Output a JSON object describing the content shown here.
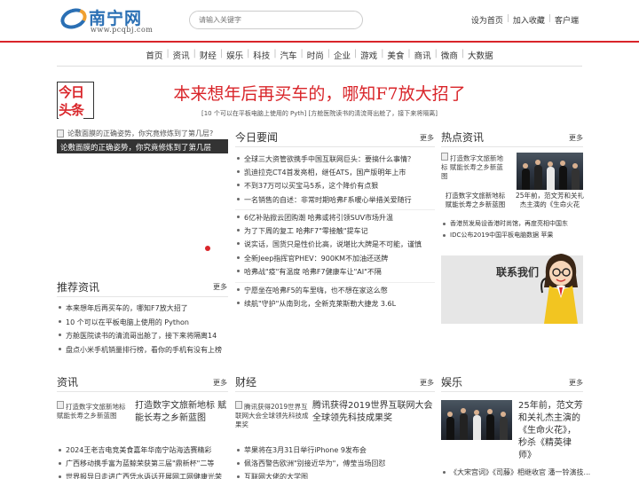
{
  "header": {
    "logo_text": "南宁网",
    "logo_url": "www.pcqbj.com",
    "search_placeholder": "请输入关键字",
    "links": [
      "设为首页",
      "加入收藏",
      "客户端"
    ]
  },
  "nav": [
    "首页",
    "资讯",
    "财经",
    "娱乐",
    "科技",
    "汽车",
    "时尚",
    "企业",
    "游戏",
    "美食",
    "商讯",
    "微商",
    "大数据"
  ],
  "headline": {
    "badge_top": "今日",
    "badge_bottom": "头条",
    "title": "本来想年后再买车的，哪知F7放大招了",
    "sub": "[10 个可以在平板电脑上使用的 Pyth]  [方舱医院读书的清流哥出舱了，接下来将隔离]"
  },
  "banner": {
    "img_alt": "论敷面膜的正确姿势，你究竟修炼到了第几层?",
    "caption": "论敷面膜的正确姿势，你究竟修炼到了第几层"
  },
  "today": {
    "title": "今日要闻",
    "more": "更多",
    "group1": [
      "全球三大资管欲携手中国互联网巨头：要搞什么事情？",
      "凯迪拉克CT4首发亮相，继任ATS，国产版明年上市",
      "不到37万可以买宝马5系，这个降价有点狠",
      "一名销售的自述：非常时期哈弗F系暖心举措关爱随行"
    ],
    "group2": [
      "6亿补贴掀云团购潮 哈弗或将引领SUV市场升温",
      "为了下周的复工 哈弗F7\"零接触\"提车记",
      "说实话，国货只是性价比高，说堪比大牌是不可能，谨慎",
      "全新Jeep指挥官PHEV：900KM不加油还送牌",
      "哈弗战\"疫\"有温度 哈弗F7健康车让\"AI\"不隔"
    ],
    "group3": [
      "宁愿坐在哈弗F5的车里嗨，也不想在家这么憋",
      "续航\"守护\"从南到北，全新克莱斯勒大捷龙 3.6L"
    ]
  },
  "hot": {
    "title": "热点资讯",
    "more": "更多",
    "thumb1_alt": "打造数字文旅新地标 赋能长寿之乡新蓝图",
    "thumb1_cap": "打造数字文旅新地标 赋能长寿之乡新蓝图",
    "thumb2_cap": "25年前，范文芳和关礼杰主演的《生命火花",
    "list": [
      "香港贸发局设香港时尚馆，再度亮相中国东",
      "IDC公布2019中国平板电脑数据 苹果"
    ]
  },
  "contact": {
    "label": "联系我们"
  },
  "recommend": {
    "title": "推荐资讯",
    "more": "更多",
    "list": [
      "本来想年后再买车的，哪知F7放大招了",
      "10 个可以在平板电脑上使用的 Python",
      "方舱医院读书的清流哥出舱了，接下来将隔离14",
      "盘点小米手机销量排行榜，看你的手机有没有上榜"
    ]
  },
  "zixun": {
    "title": "资讯",
    "more": "更多",
    "img_alt": "打造数字文旅新地标 赋能长寿之乡新蓝图",
    "big": "打造数字文旅新地标 赋能长寿之乡新蓝图",
    "list": [
      "2024王老吉电竞美食嘉年华南宁站海选赛精彩",
      "广西移动携手富为蓝鲸荣获第三届\"鼎新杯\"二等",
      "世界报导日走进广西凭水语话开展网工网健康光荣"
    ]
  },
  "caijing": {
    "title": "财经",
    "more": "更多",
    "img_alt": "腾讯获得2019世界互联网大会全球领先科技成果奖",
    "big": "腾讯获得2019世界互联网大会全球领先科技成果奖",
    "list": [
      "苹果将在3月31日举行iPhone 9发布会",
      "佩洛西警告欧洲\"别接近华为\"，傅莹当场回怼",
      "互联网大佬的大学图"
    ]
  },
  "yule": {
    "title": "娱乐",
    "more": "更多",
    "big": "25年前，范文芳和关礼杰主演的《生命火花》，秒杀《精英律师》",
    "list": [
      "《大宋宫词》《司藤》相继收官 潘一铃演技..."
    ]
  }
}
